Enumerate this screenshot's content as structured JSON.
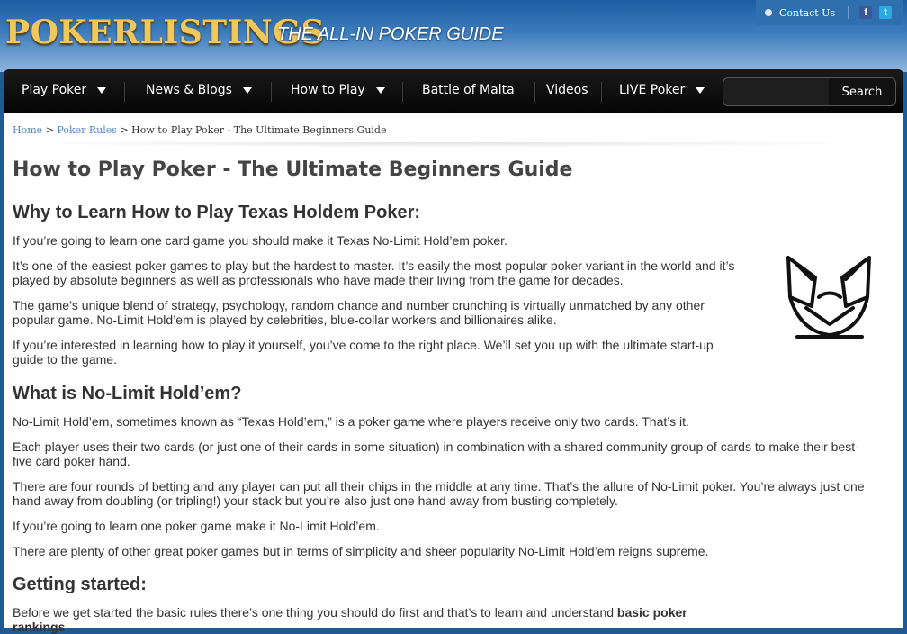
{
  "header": {
    "logo_text": "POKERLISTINGS",
    "tagline": "THE ALL-IN POKER GUIDE",
    "contact_label": "Contact Us",
    "social": {
      "facebook": "f",
      "twitter": "t"
    }
  },
  "nav": {
    "items": [
      {
        "label": "Play Poker",
        "dropdown": true
      },
      {
        "label": "News & Blogs",
        "dropdown": true
      },
      {
        "label": "How to Play",
        "dropdown": true
      },
      {
        "label": "Battle of Malta",
        "dropdown": false
      },
      {
        "label": "Videos",
        "dropdown": false
      },
      {
        "label": "LIVE Poker",
        "dropdown": true
      }
    ],
    "search": {
      "value": "",
      "placeholder": "",
      "button_label": "Search"
    }
  },
  "breadcrumb": {
    "home": "Home",
    "sep1": ">",
    "rules": "Poker Rules",
    "sep2": ">",
    "current": "How to Play Poker - The Ultimate Beginners Guide"
  },
  "article": {
    "title": "How to Play Poker - The Ultimate Beginners Guide",
    "sections": {
      "why": {
        "heading": "Why to Learn How to Play Texas Holdem Poker:",
        "p1": "If you’re going to learn one card game you should make it Texas No-Limit Hold’em poker.",
        "p2a": "It’s one of the easiest poker games to play but the hardest to master. It’s easily the most popular poker variant in the world and it’s",
        "p2b": "played by absolute beginners as well as professionals who have made their living from the game for decades.",
        "p3a": "The game’s unique blend of strategy, psychology, random chance and number crunching is virtually unmatched by any other",
        "p3b": "popular game. No-Limit Hold’em is played by celebrities, blue-collar workers and billionaires alike.",
        "p4a": "If you’re interested in learning how to play it yourself, you’ve come to the right place. We’ll set you up with the ultimate start-up",
        "p4b": "guide to the game."
      },
      "what": {
        "heading": "What is No-Limit Hold’em?",
        "p1": "No-Limit Hold’em, sometimes known as “Texas Hold’em,” is a poker game where players receive only two cards. That’s it.",
        "p2a": "Each player uses their two cards (or just one of their cards in some situation) in combination with a shared community group of cards to make their best-",
        "p2b": "five card poker hand.",
        "p3a": "There are four rounds of betting and any player can put all their chips in the middle at any time. That’s the allure of No-Limit poker. You’re always just one",
        "p3b": "hand away from doubling (or tripling!) your stack but you’re also just one hand away from busting completely.",
        "p4": "If you’re going to learn one poker game make it No-Limit Hold’em.",
        "p5": "There are plenty of other great poker games but in terms of simplicity and sheer popularity No-Limit Hold’em reigns supreme."
      },
      "start": {
        "heading": "Getting started:",
        "p1_text": "Before we get started the basic rules there’s one thing you should do first and that’s to learn and understand ",
        "p1_bold_a": "basic poker",
        "p1_bold_b": "rankings"
      }
    },
    "side_icon": "poker-cards-hand-icon"
  },
  "colors": {
    "nav_bg": "#0b0b0b",
    "header_blue": "#2f6fae",
    "link": "#4f86c6",
    "logo_gold": "#f0c75a"
  }
}
